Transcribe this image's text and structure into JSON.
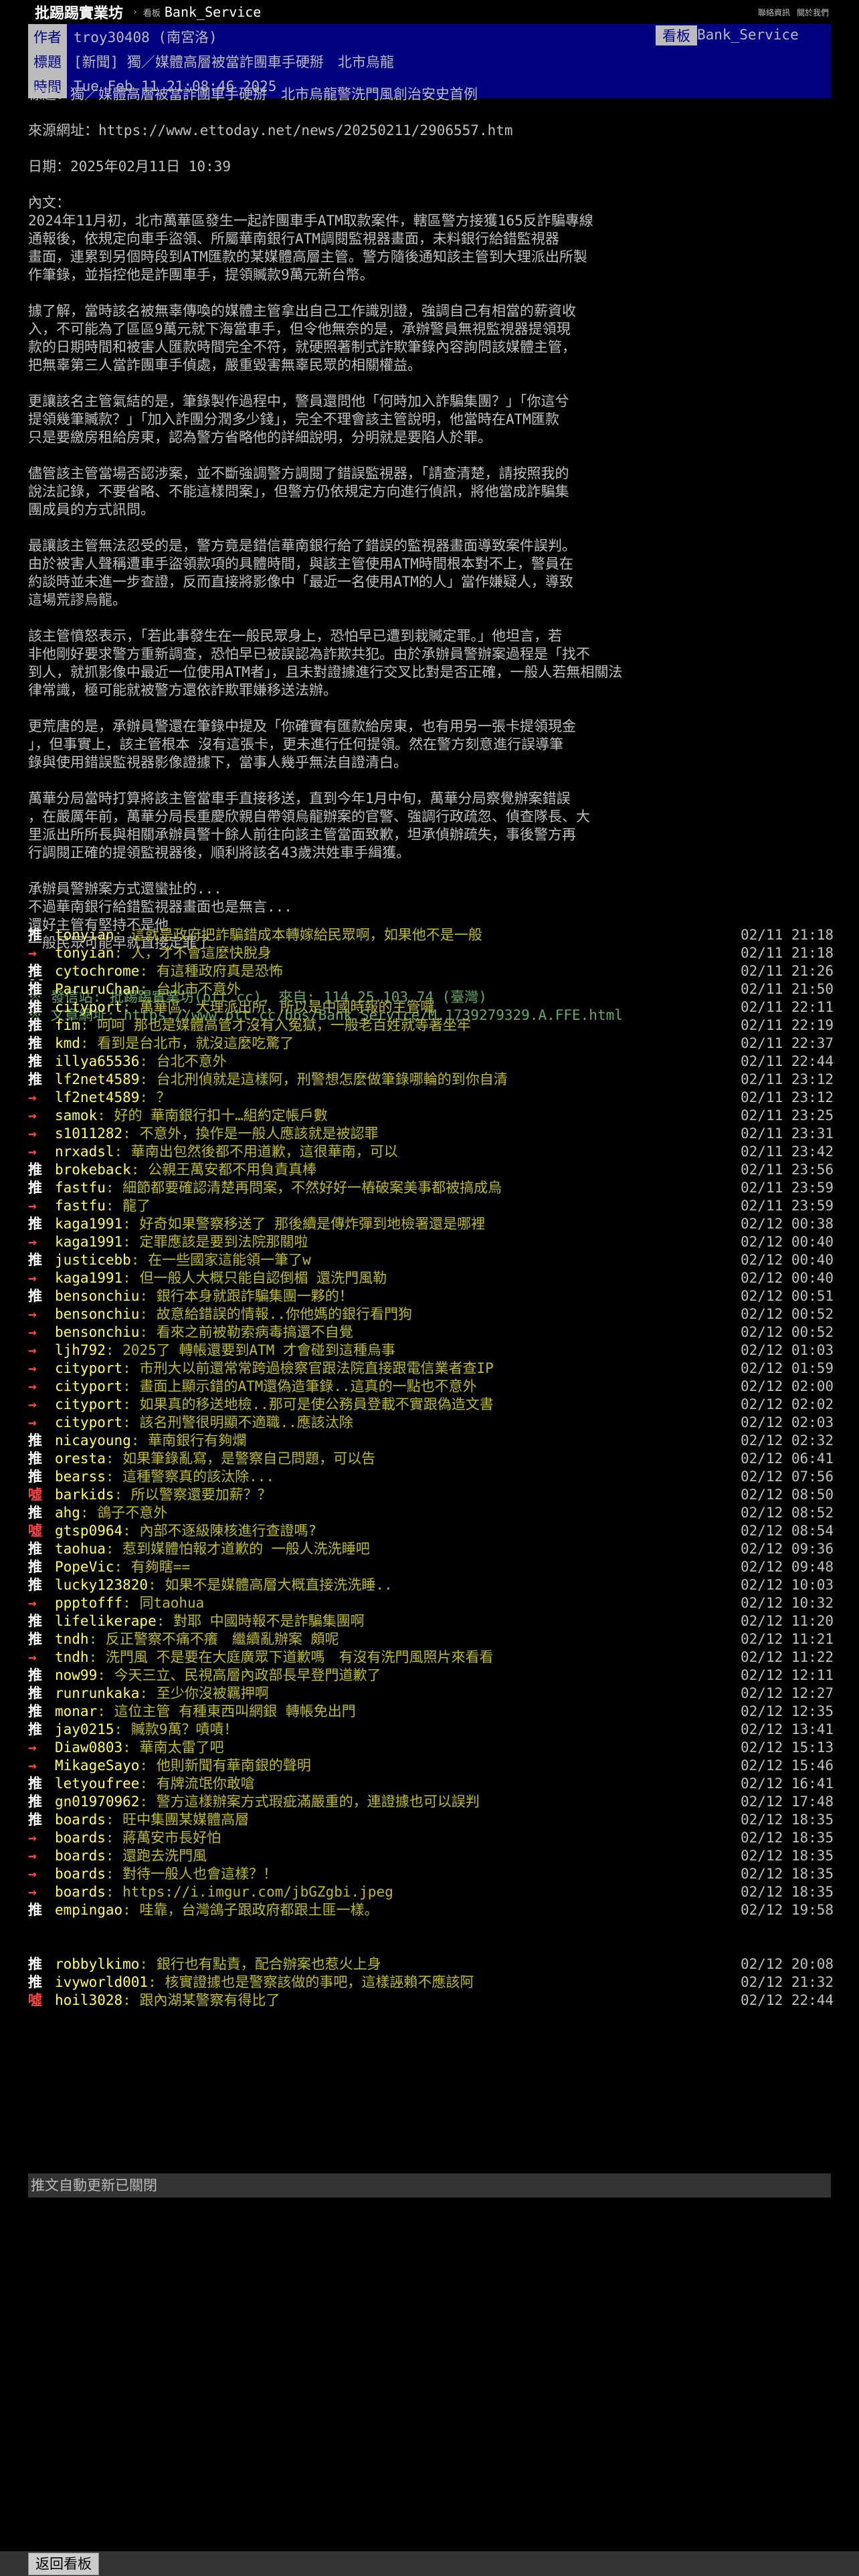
{
  "topbar": {
    "site_name": "批踢踢實業坊",
    "separator": "›",
    "board_label": "看板",
    "board_name": "Bank_Service",
    "links": [
      "聯絡資訊",
      "關於我們"
    ]
  },
  "meta": {
    "author_tag": "作者",
    "author": "troy30408 (南宮洛)",
    "board_tag": "看板",
    "board": "Bank_Service",
    "title_tag": "標題",
    "title": "[新聞] 獨／媒體高層被當詐團車手硬掰　北市烏龍",
    "time_tag": "時間",
    "time": "Tue Feb 11 21:08:46 2025"
  },
  "body_lines": [
    "標題：獨／媒體高層被當詐團車手硬掰　北市烏龍警洗門風創治安史首例",
    "",
    "來源網址：https://www.ettoday.net/news/20250211/2906557.htm",
    "",
    "日期：2025年02月11日 10:39",
    "",
    "內文："
  ],
  "paragraphs": [
    [
      "2024年11月初，北市萬華區發生一起詐團車手ATM取款案件，轄區警方接獲165反詐騙專線",
      "通報後，依規定向車手盜領、所屬華南銀行ATM調閱監視器畫面，未料銀行給錯監視器",
      "畫面，連累到另個時段到ATM匯款的某媒體高層主管。警方隨後通知該主管到大理派出所製",
      "作筆錄，並指控他是詐團車手，提領贓款9萬元新台幣。"
    ],
    [
      "據了解，當時該名被無辜傳喚的媒體主管拿出自己工作識別證，強調自己有相當的薪資收",
      "入，不可能為了區區9萬元就下海當車手，但令他無奈的是，承辦警員無視監視器提領現",
      "款的日期時間和被害人匯款時間完全不符，就硬照著制式詐欺筆錄內容詢問該媒體主管，",
      "把無辜第三人當詐團車手偵處，嚴重毀害無辜民眾的相關權益。"
    ],
    [
      "更讓該名主管氣結的是，筆錄製作過程中，警員還問他「何時加入詐騙集團？」「你這兮",
      "提領幾筆贓款？」「加入詐團分潤多少錢」，完全不理會該主管說明，他當時在ATM匯款",
      "只是要繳房租給房東，認為警方省略他的詳細說明，分明就是要陷人於罪。"
    ],
    [
      "儘管該主管當場否認涉案，並不斷強調警方調閱了錯誤監視器，「請查清楚，請按照我的",
      "說法記錄，不要省略、不能這樣問案」，但警方仍依規定方向進行偵訊，將他當成詐騙集",
      "團成員的方式訊問。"
    ],
    [
      "最讓該主管無法忍受的是，警方竟是錯信華南銀行給了錯誤的監視器畫面導致案件誤判。",
      "由於被害人聲稱遭車手盜領款項的具體時間，與該主管使用ATM時間根本對不上，警員在",
      "約談時並未進一步查證，反而直接將影像中「最近一名使用ATM的人」當作嫌疑人，導致",
      "這場荒謬烏龍。"
    ],
    [
      "該主管憤怒表示，「若此事發生在一般民眾身上，恐怕早已遭到栽贓定罪。」他坦言，若",
      "非他剛好要求警方重新調查，恐怕早已被誤認為詐欺共犯。由於承辦員警辦案過程是「找不",
      "到人，就抓影像中最近一位使用ATM者」，且未對證據進行交叉比對是否正確，一般人若無相關法",
      "律常識，極可能就被警方還依詐欺罪嫌移送法辦。"
    ],
    [
      "更荒唐的是，承辦員警還在筆錄中提及「你確實有匯款給房東，也有用另一張卡提領現金",
      "」，但事實上，該主管根本 沒有這張卡，更未進行任何提領。然在警方刻意進行誤導筆",
      "錄與使用錯誤監視器影像證據下，當事人幾乎無法自證清白。"
    ],
    [
      "萬華分局當時打算將該主管當車手直接移送，直到今年1月中旬，萬華分局察覺辦案錯誤",
      "，在嚴厲年前，萬華分局長重慶欣親自帶領烏龍辦案的官警、強調行政疏忽、偵查隊長、大",
      "里派出所所長與相關承辦員警十餘人前往向該主管當面致歉，坦承偵辦疏失，事後警方再",
      "行調閱正確的提領監視器後，順利將該名43歲洪姓車手緝獲。"
    ],
    [
      "承辦員警辦案方式還蠻扯的...",
      "不過華南銀行給錯監視器畫面也是無言...",
      "還好主管有堅持不是他",
      "一般民眾可能早就直接定罪了"
    ]
  ],
  "signature": {
    "dashes": "--",
    "from_line": "※ 發信站: 批踢踢實業坊(ptt.cc), 來自: 114.25.103.74 (臺灣)",
    "url_line": "※ 文章網址: https://www.ptt.cc/bbs/Bank_Service/M.1739279329.A.FFE.html"
  },
  "pushes": [
    {
      "tag": "推",
      "user": "tonyian",
      "content": ": 這就是政府把詐騙錯成本轉嫁給民眾啊，如果他不是一般",
      "time": "02/11 21:18"
    },
    {
      "tag": "→",
      "user": "tonyian",
      "content": ": 人，才不會這麼快脫身",
      "time": "02/11 21:18"
    },
    {
      "tag": "推",
      "user": "cytochrome",
      "content": ": 有這種政府真是恐怖",
      "time": "02/11 21:26"
    },
    {
      "tag": "推",
      "user": "ParuruChan",
      "content": ": 台北市不意外",
      "time": "02/11 21:50"
    },
    {
      "tag": "推",
      "user": "cityport",
      "content": ": 萬華區、大理派出所，所以是中國時報的主管囉",
      "time": "02/11 22:11"
    },
    {
      "tag": "推",
      "user": "fim",
      "content": ": 呵呵 那也是媒體高管才沒有入冤獄，一般老百姓就等著坐牢",
      "time": "02/11 22:19"
    },
    {
      "tag": "推",
      "user": "kmd",
      "content": ": 看到是台北市，就沒這麼吃驚了",
      "time": "02/11 22:37"
    },
    {
      "tag": "推",
      "user": "illya65536",
      "content": ": 台北不意外",
      "time": "02/11 22:44"
    },
    {
      "tag": "推",
      "user": "lf2net4589",
      "content": ": 台北刑偵就是這樣阿，刑警想怎麼做筆錄哪輪的到你自清",
      "time": "02/11 23:12"
    },
    {
      "tag": "→",
      "user": "lf2net4589",
      "content": ": ？",
      "time": "02/11 23:12"
    },
    {
      "tag": "→",
      "user": "samok",
      "content": ": 好的 華南銀行扣十…組約定帳戶數",
      "time": "02/11 23:25"
    },
    {
      "tag": "→",
      "user": "s1011282",
      "content": ": 不意外，換作是一般人應該就是被認罪",
      "time": "02/11 23:31"
    },
    {
      "tag": "→",
      "user": "nrxadsl",
      "content": ": 華南出包然後都不用道歉，這很華南，可以",
      "time": "02/11 23:42"
    },
    {
      "tag": "推",
      "user": "brokeback",
      "content": ": 公親王萬安都不用負責真棒",
      "time": "02/11 23:56"
    },
    {
      "tag": "推",
      "user": "fastfu",
      "content": ": 細節都要確認清楚再問案，不然好好一樁破案美事都被搞成烏",
      "time": "02/11 23:59"
    },
    {
      "tag": "→",
      "user": "fastfu",
      "content": ": 龍了",
      "time": "02/11 23:59"
    },
    {
      "tag": "推",
      "user": "kaga1991",
      "content": ": 好奇如果警察移送了 那後續是傳炸彈到地檢署還是哪裡",
      "time": "02/12 00:38"
    },
    {
      "tag": "→",
      "user": "kaga1991",
      "content": ": 定罪應該是要到法院那關啦",
      "time": "02/12 00:40"
    },
    {
      "tag": "推",
      "user": "justicebb",
      "content": ": 在一些國家這能領一筆了w",
      "time": "02/12 00:40"
    },
    {
      "tag": "→",
      "user": "kaga1991",
      "content": ": 但一般人大概只能自認倒楣 還洗門風勒",
      "time": "02/12 00:40"
    },
    {
      "tag": "推",
      "user": "bensonchiu",
      "content": ": 銀行本身就跟詐騙集團一夥的！",
      "time": "02/12 00:51"
    },
    {
      "tag": "→",
      "user": "bensonchiu",
      "content": ": 故意給錯誤的情報..你他媽的銀行看門狗",
      "time": "02/12 00:52"
    },
    {
      "tag": "→",
      "user": "bensonchiu",
      "content": ": 看來之前被勒索病毒搞還不自覺",
      "time": "02/12 00:52"
    },
    {
      "tag": "→",
      "user": "ljh792",
      "content": ": 2025了 轉帳還要到ATM 才會碰到這種烏事",
      "time": "02/12 01:03"
    },
    {
      "tag": "→",
      "user": "cityport",
      "content": ": 市刑大以前還常常跨過檢察官跟法院直接跟電信業者查IP",
      "time": "02/12 01:59"
    },
    {
      "tag": "→",
      "user": "cityport",
      "content": ": 畫面上顯示錯的ATM還偽造筆錄..這真的一點也不意外",
      "time": "02/12 02:00"
    },
    {
      "tag": "→",
      "user": "cityport",
      "content": ": 如果真的移送地檢..那可是使公務員登載不實跟偽造文書",
      "time": "02/12 02:02"
    },
    {
      "tag": "→",
      "user": "cityport",
      "content": ": 該名刑警很明顯不適職..應該汰除",
      "time": "02/12 02:03"
    },
    {
      "tag": "推",
      "user": "nicayoung",
      "content": ": 華南銀行有夠爛",
      "time": "02/12 02:32"
    },
    {
      "tag": "推",
      "user": "oresta",
      "content": ": 如果筆錄亂寫，是警察自己問題，可以告",
      "time": "02/12 06:41"
    },
    {
      "tag": "推",
      "user": "bearss",
      "content": ": 這種警察真的該汰除...",
      "time": "02/12 07:56"
    },
    {
      "tag": "噓",
      "user": "barkids",
      "content": ": 所以警察還要加薪？？",
      "time": "02/12 08:50"
    },
    {
      "tag": "推",
      "user": "ahg",
      "content": ": 鴿子不意外",
      "time": "02/12 08:52"
    },
    {
      "tag": "噓",
      "user": "gtsp0964",
      "content": ": 內部不逐級陳核進行查證嗎?",
      "time": "02/12 08:54"
    },
    {
      "tag": "推",
      "user": "taohua",
      "content": ": 惹到媒體怕報才道歉的 一般人洗洗睡吧",
      "time": "02/12 09:36"
    },
    {
      "tag": "推",
      "user": "PopeVic",
      "content": ": 有夠瞎==",
      "time": "02/12 09:48"
    },
    {
      "tag": "推",
      "user": "lucky123820",
      "content": ": 如果不是媒體高層大概直接洗洗睡..",
      "time": "02/12 10:03"
    },
    {
      "tag": "→",
      "user": "ppptofff",
      "content": ": 同taohua",
      "time": "02/12 10:32"
    },
    {
      "tag": "推",
      "user": "lifelikerape",
      "content": ": 對耶 中國時報不是詐騙集團啊",
      "time": "02/12 11:20"
    },
    {
      "tag": "推",
      "user": "tndh",
      "content": ": 反正警察不痛不癢　繼續亂辦案 頗呢",
      "time": "02/12 11:21"
    },
    {
      "tag": "→",
      "user": "tndh",
      "content": ": 洗門風 不是要在大庭廣眾下道歉嗎　有沒有洗門風照片來看看",
      "time": "02/12 11:22"
    },
    {
      "tag": "推",
      "user": "now99",
      "content": ": 今天三立、民視高層內政部長早登門道歉了",
      "time": "02/12 12:11"
    },
    {
      "tag": "推",
      "user": "runrunkaka",
      "content": ": 至少你沒被羈押啊",
      "time": "02/12 12:27"
    },
    {
      "tag": "推",
      "user": "monar",
      "content": ": 這位主管 有種東西叫網銀 轉帳免出門",
      "time": "02/12 12:35"
    },
    {
      "tag": "推",
      "user": "jay0215",
      "content": ": 贓款9萬？嘖嘖！",
      "time": "02/12 13:41"
    },
    {
      "tag": "→",
      "user": "Diaw0803",
      "content": ": 華南太雷了吧",
      "time": "02/12 15:13"
    },
    {
      "tag": "→",
      "user": "MikageSayo",
      "content": ": 他則新聞有華南銀的聲明",
      "time": "02/12 15:46"
    },
    {
      "tag": "推",
      "user": "letyoufree",
      "content": ": 有牌流氓你敢嗆",
      "time": "02/12 16:41"
    },
    {
      "tag": "推",
      "user": "gn01970962",
      "content": ": 警方這樣辦案方式瑕疵滿嚴重的，連證據也可以誤判",
      "time": "02/12 17:48"
    },
    {
      "tag": "推",
      "user": "boards",
      "content": ": 旺中集團某媒體高層",
      "time": "02/12 18:35"
    },
    {
      "tag": "→",
      "user": "boards",
      "content": ": 蔣萬安市長好怕",
      "time": "02/12 18:35"
    },
    {
      "tag": "→",
      "user": "boards",
      "content": ": 還跑去洗門風",
      "time": "02/12 18:35"
    },
    {
      "tag": "→",
      "user": "boards",
      "content": ": 對待一般人也會這樣？！",
      "time": "02/12 18:35"
    },
    {
      "tag": "→",
      "user": "boards",
      "content": ":  https://i.imgur.com/jbGZgbi.jpeg",
      "time": "02/12 18:35"
    },
    {
      "tag": "推",
      "user": "empingao",
      "content": ": 哇靠，台灣鴿子跟政府都跟土匪一樣。",
      "time": "02/12 19:58"
    },
    {
      "tag": "推",
      "user": "robbylkimo",
      "content": ": 銀行也有點責，配合辦案也惹火上身",
      "time": "02/12 20:08"
    },
    {
      "tag": "推",
      "user": "ivyworld001",
      "content": ": 核實證據也是警察該做的事吧，這樣誣賴不應該阿",
      "time": "02/12 21:32"
    },
    {
      "tag": "噓",
      "user": "hoil3028",
      "content": ": 跟內湖某警察有得比了",
      "time": "02/12 22:44"
    }
  ],
  "auto_update_text": "推文自動更新已關閉",
  "back_button": "返回看板"
}
